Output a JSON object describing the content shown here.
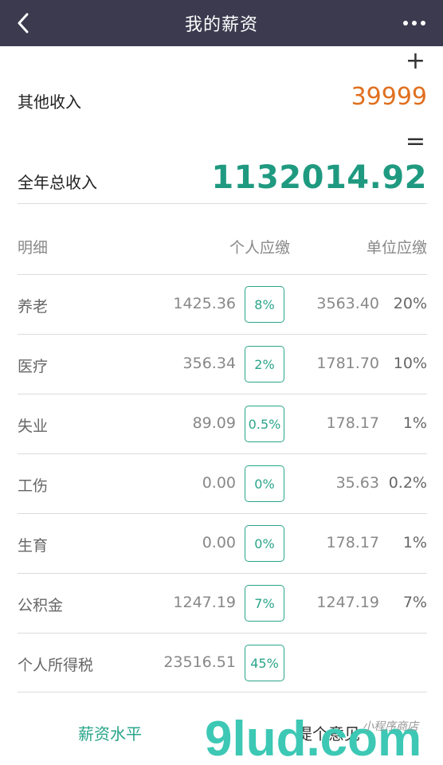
{
  "navbar": {
    "title": "我的薪资"
  },
  "summary": {
    "plus_sign": "+",
    "equal_sign": "=",
    "other_income_label": "其他收入",
    "other_income_value": "39999",
    "total_income_label": "全年总收入",
    "total_income_value": "1132014.92"
  },
  "table_header": {
    "detail": "明细",
    "personal": "个人应缴",
    "company": "单位应缴"
  },
  "rows": [
    {
      "name": "养老",
      "personal_amount": "1425.36",
      "personal_rate": "8%",
      "company_amount": "3563.40",
      "company_rate": "20%"
    },
    {
      "name": "医疗",
      "personal_amount": "356.34",
      "personal_rate": "2%",
      "company_amount": "1781.70",
      "company_rate": "10%"
    },
    {
      "name": "失业",
      "personal_amount": "89.09",
      "personal_rate": "0.5%",
      "company_amount": "178.17",
      "company_rate": "1%"
    },
    {
      "name": "工伤",
      "personal_amount": "0.00",
      "personal_rate": "0%",
      "company_amount": "35.63",
      "company_rate": "0.2%"
    },
    {
      "name": "生育",
      "personal_amount": "0.00",
      "personal_rate": "0%",
      "company_amount": "178.17",
      "company_rate": "1%"
    },
    {
      "name": "公积金",
      "personal_amount": "1247.19",
      "personal_rate": "7%",
      "company_amount": "1247.19",
      "company_rate": "7%"
    },
    {
      "name": "个人所得税",
      "personal_amount": "23516.51",
      "personal_rate": "45%",
      "company_amount": "",
      "company_rate": ""
    }
  ],
  "tabbar": {
    "salary_level": "薪资水平",
    "feedback": "提个意见"
  },
  "watermark": {
    "logo": "9lud.com",
    "tagline": "小程序商店"
  },
  "colors": {
    "navbar": "#3b3a4f",
    "accent": "#2aa58a",
    "total": "#1f9a80",
    "other_income": "#e07020"
  }
}
